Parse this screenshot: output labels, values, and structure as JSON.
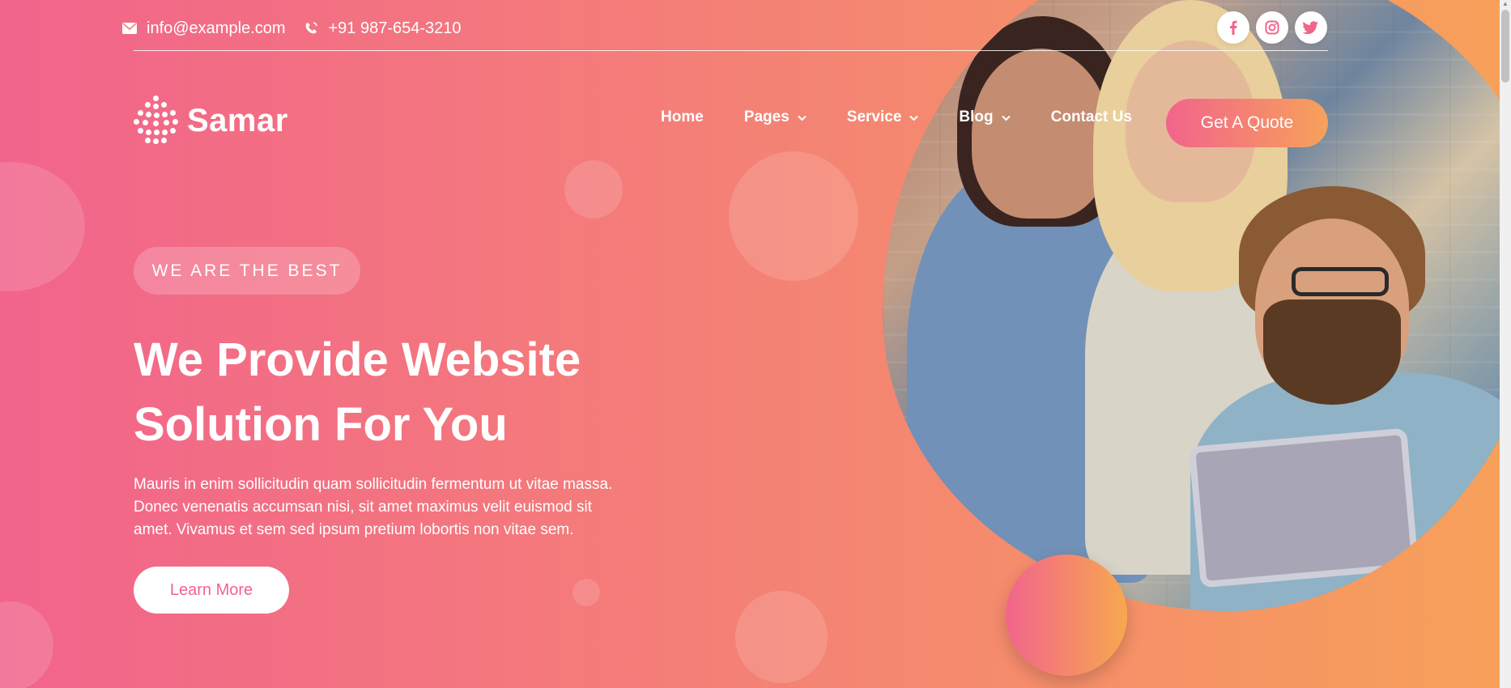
{
  "topbar": {
    "email": "info@example.com",
    "phone": "+91 987-654-3210",
    "email_icon": "envelope-icon",
    "phone_icon": "phone-icon"
  },
  "social": [
    {
      "name": "facebook-icon",
      "glyph": "f"
    },
    {
      "name": "instagram-icon",
      "glyph": "◎"
    },
    {
      "name": "twitter-icon",
      "glyph": "🐦"
    }
  ],
  "brand": {
    "name": "Samar"
  },
  "nav": {
    "items": [
      {
        "label": "Home",
        "has_dropdown": false
      },
      {
        "label": "Pages",
        "has_dropdown": true
      },
      {
        "label": "Service",
        "has_dropdown": true
      },
      {
        "label": "Blog",
        "has_dropdown": true
      },
      {
        "label": "Contact Us",
        "has_dropdown": false
      }
    ],
    "cta": "Get A Quote"
  },
  "hero": {
    "tagline": "WE ARE THE BEST",
    "headline_line1": "We Provide Website",
    "headline_line2": "Solution For You",
    "lead_line1": "Mauris in enim sollicitudin quam sollicitudin fermentum ut vitae massa.",
    "lead_line2": "Donec venenatis accumsan nisi, sit amet maximus velit euismod sit",
    "lead_line3": "amet. Vivamus et sem sed ipsum pretium lobortis non vitae sem.",
    "button": "Learn More"
  },
  "colors": {
    "gradient_start": "#f2648c",
    "gradient_end": "#f7a15a",
    "accent": "#f2648c"
  }
}
